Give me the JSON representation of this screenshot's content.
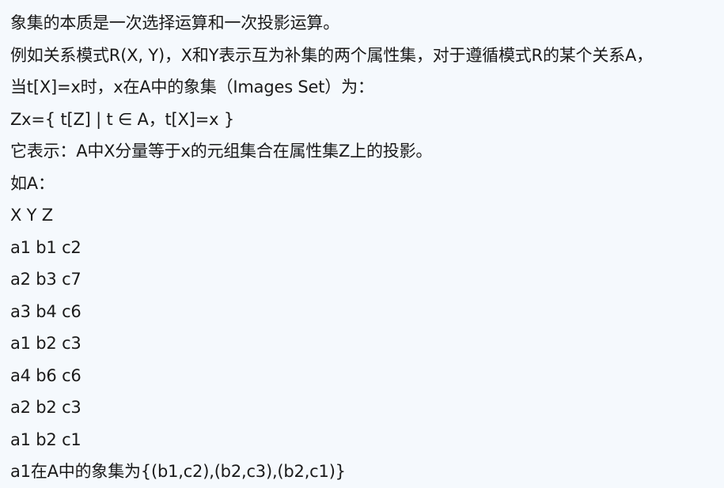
{
  "content": {
    "lines": [
      "象集的本质是一次选择运算和一次投影运算。",
      "例如关系模式R(X, Y)，X和Y表示互为补集的两个属性集，对于遵循模式R的某个关系A，",
      "当t[X]=x时，x在A中的象集（Images Set）为：",
      "Zx={ t[Z] | t ∈ A，t[X]=x }",
      "它表示：A中X分量等于x的元组集合在属性集Z上的投影。",
      "如A：",
      "X Y Z",
      "a1 b1 c2",
      "a2 b3 c7",
      "a3 b4 c6",
      "a1 b2 c3",
      "a4 b6 c6",
      "a2 b2 c3",
      "a1 b2 c1",
      "a1在A中的象集为{(b1,c2),(b2,c3),(b2,c1)}"
    ]
  }
}
